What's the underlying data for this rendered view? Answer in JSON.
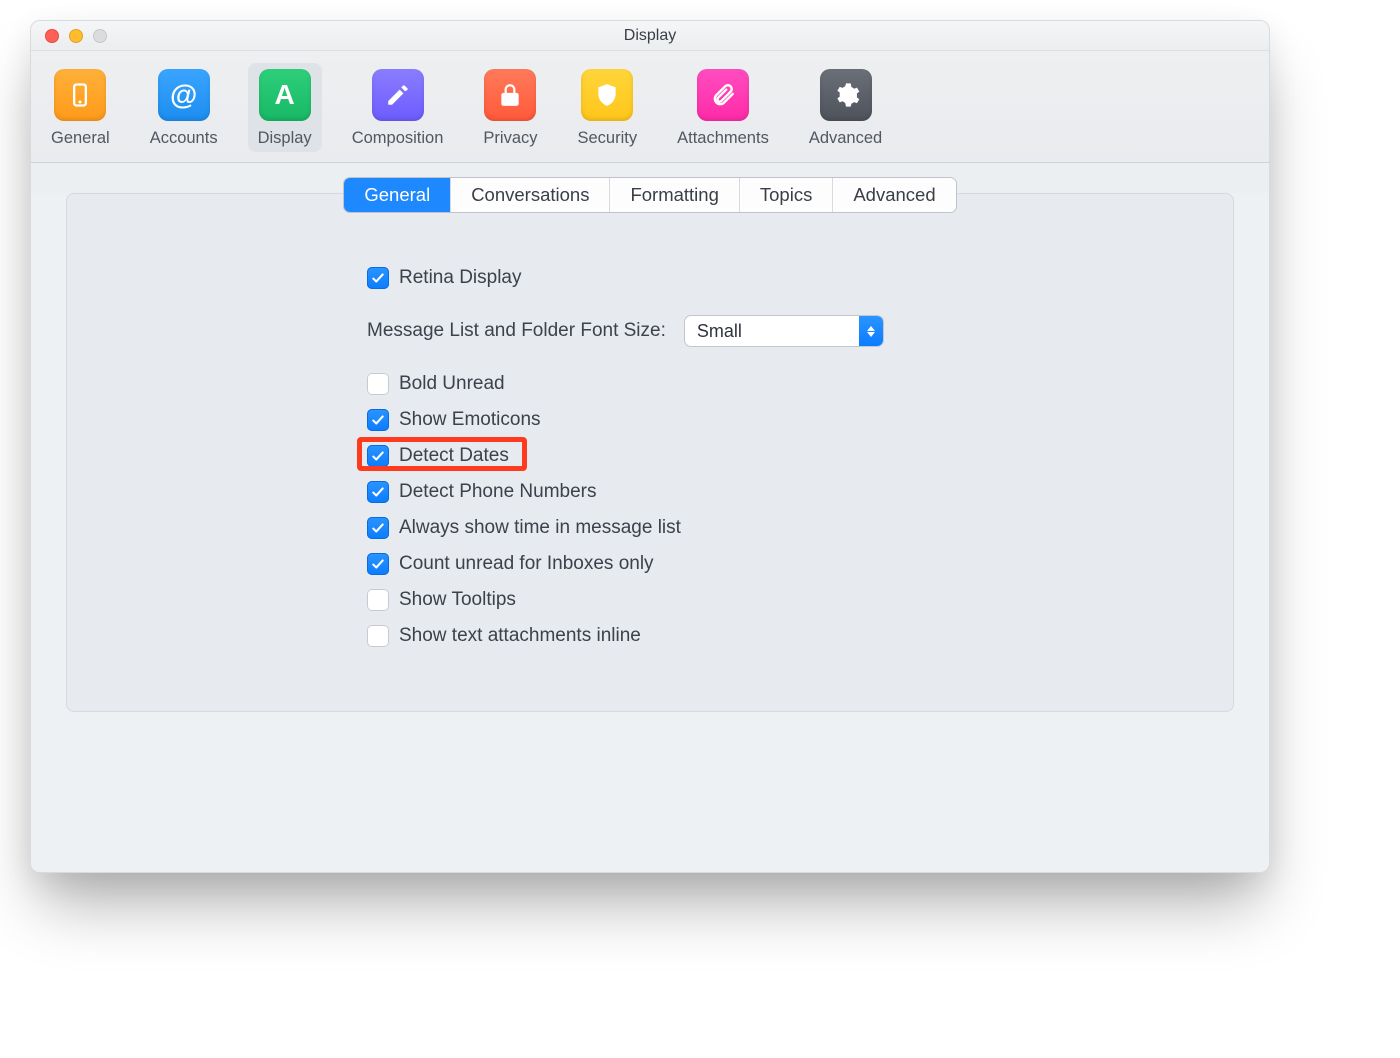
{
  "window": {
    "title": "Display"
  },
  "toolbar": {
    "items": [
      {
        "label": "General"
      },
      {
        "label": "Accounts"
      },
      {
        "label": "Display"
      },
      {
        "label": "Composition"
      },
      {
        "label": "Privacy"
      },
      {
        "label": "Security"
      },
      {
        "label": "Attachments"
      },
      {
        "label": "Advanced"
      }
    ]
  },
  "tabs": {
    "items": [
      {
        "label": "General"
      },
      {
        "label": "Conversations"
      },
      {
        "label": "Formatting"
      },
      {
        "label": "Topics"
      },
      {
        "label": "Advanced"
      }
    ]
  },
  "settings": {
    "retina_display": {
      "label": "Retina Display",
      "checked": true
    },
    "font_size": {
      "label": "Message List and Folder Font Size:",
      "value": "Small"
    },
    "bold_unread": {
      "label": "Bold Unread",
      "checked": false
    },
    "show_emoticons": {
      "label": "Show Emoticons",
      "checked": true
    },
    "detect_dates": {
      "label": "Detect Dates",
      "checked": true
    },
    "detect_phone": {
      "label": "Detect Phone Numbers",
      "checked": true
    },
    "always_show_time": {
      "label": "Always show time in message list",
      "checked": true
    },
    "count_unread_inboxes": {
      "label": "Count unread for Inboxes only",
      "checked": true
    },
    "show_tooltips": {
      "label": "Show Tooltips",
      "checked": false
    },
    "show_text_attachments_inline": {
      "label": "Show text attachments inline",
      "checked": false
    }
  }
}
